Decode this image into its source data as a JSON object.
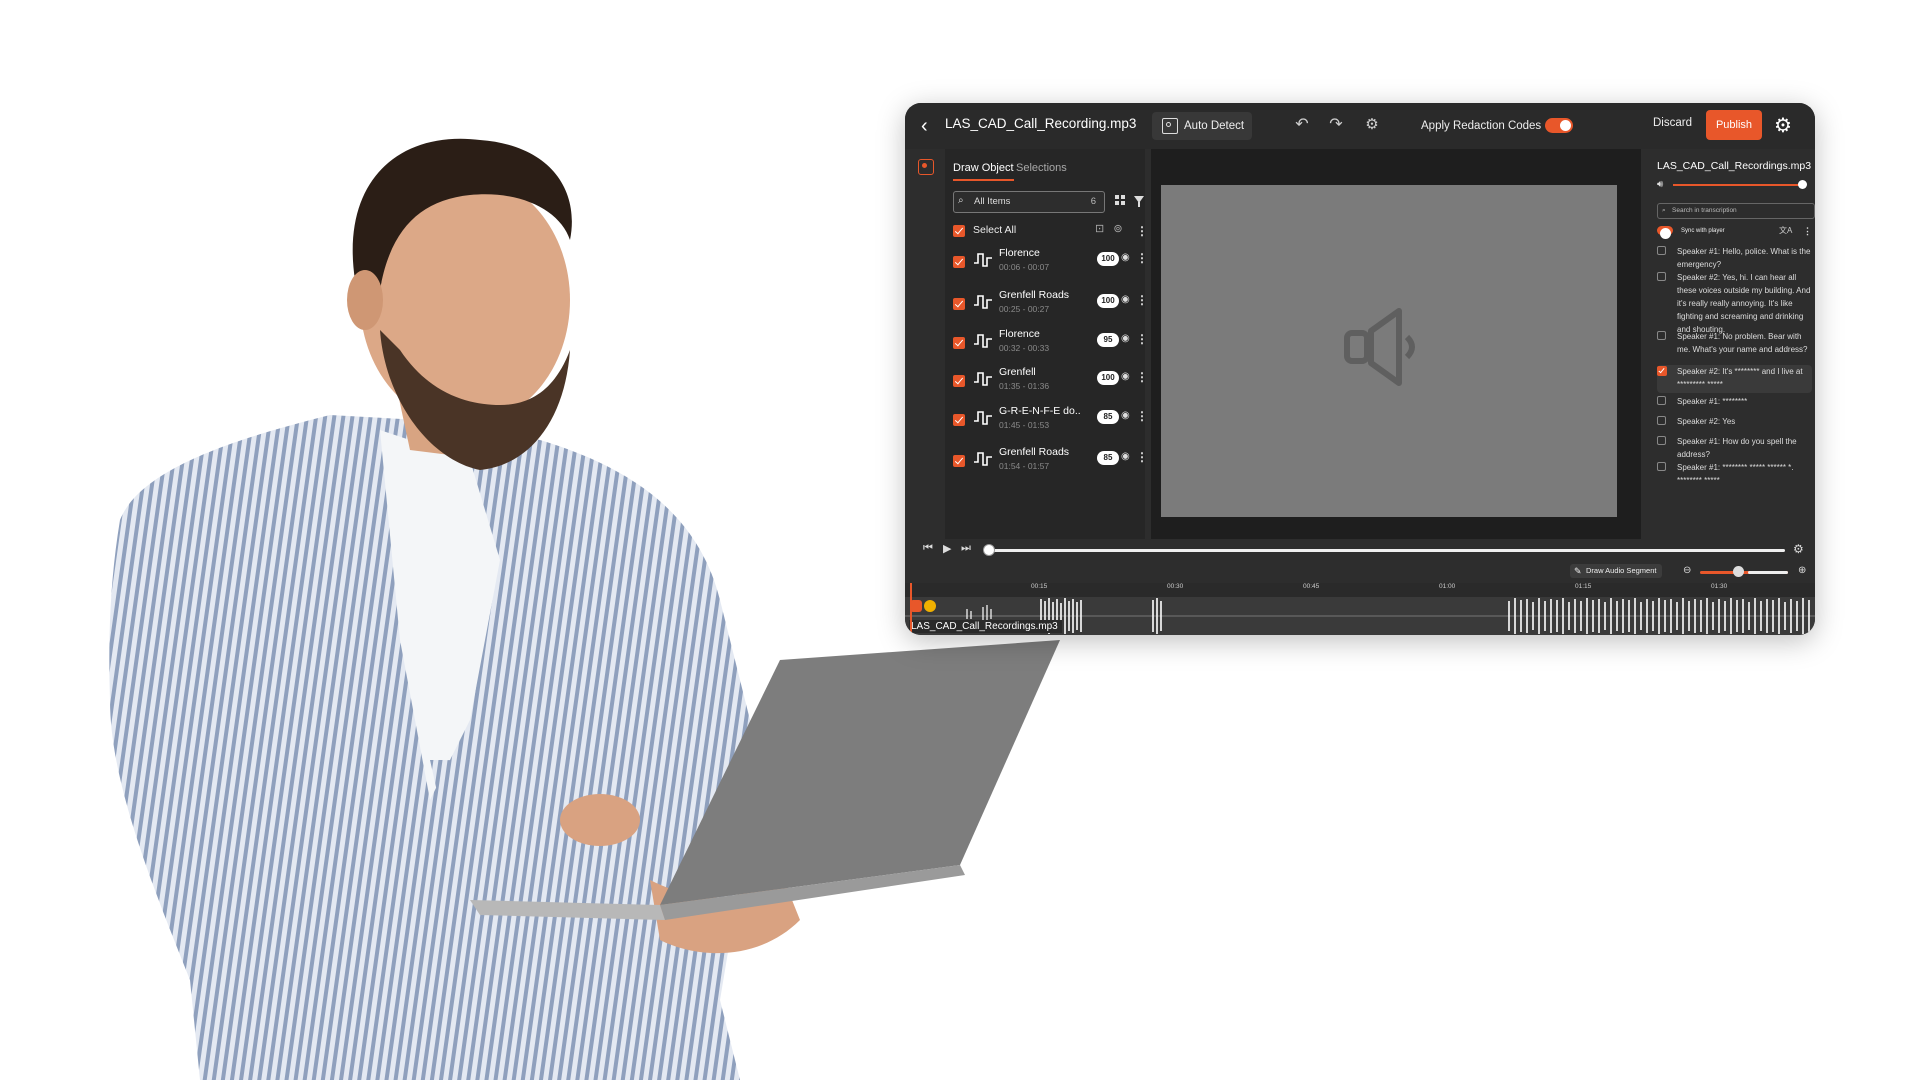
{
  "app": {
    "title": "LAS_CAD_Call_Recording.mp3",
    "auto_detect_label": "Auto Detect",
    "apply_redaction_label": "Apply Redaction Codes",
    "discard_label": "Discard",
    "publish_label": "Publish",
    "accent_color": "#e8572a"
  },
  "panel": {
    "tabs": [
      "Draw Object",
      "Selections"
    ],
    "active_tab": "Draw Object",
    "search_placeholder": "All Items",
    "item_count": "6",
    "select_all_label": "Select All",
    "items": [
      {
        "name": "Florence",
        "time": "00:06 - 00:07",
        "score": "100"
      },
      {
        "name": "Grenfell Roads",
        "time": "00:25 - 00:27",
        "score": "100"
      },
      {
        "name": "Florence",
        "time": "00:32 - 00:33",
        "score": "95"
      },
      {
        "name": "Grenfell",
        "time": "01:35 - 01:36",
        "score": "100"
      },
      {
        "name": "G-R-E-N-F-E do..",
        "time": "01:45 - 01:53",
        "score": "85"
      },
      {
        "name": "Grenfell Roads",
        "time": "01:54 - 01:57",
        "score": "85"
      }
    ]
  },
  "transcript": {
    "title": "LAS_CAD_Call_Recordings.mp3",
    "search_placeholder": "Search in transcription",
    "sync_label": "Sync with player",
    "segments": [
      {
        "text": "Speaker #1: Hello, police. What is the emergency?",
        "checked": false
      },
      {
        "text": "Speaker #2: Yes, hi. I can hear all these voices outside my building. And it's really really annoying. It's like fighting and screaming and drinking and shouting.",
        "checked": false
      },
      {
        "text": "Speaker #1: No problem. Bear with me. What's your name and address?",
        "checked": false
      },
      {
        "text": "Speaker #2: It's ******** and I live at ********* *****",
        "checked": true
      },
      {
        "text": "Speaker #1: ********",
        "checked": false
      },
      {
        "text": "Speaker #2: Yes",
        "checked": false
      },
      {
        "text": "Speaker #1: How do you spell the address?",
        "checked": false
      },
      {
        "text": "Speaker #1: ******** ***** ****** *. ******** *****",
        "checked": false
      }
    ]
  },
  "timeline": {
    "draw_audio_segment_label": "Draw Audio Segment",
    "tick_labels": [
      "00:15",
      "00:30",
      "00:45",
      "01:00",
      "01:15",
      "01:30"
    ],
    "file_name": "LAS_CAD_Call_Recordings.mp3",
    "player_progress": 0.0,
    "zoom_level": 0.35
  },
  "icons": {
    "back": "chevron-left-icon",
    "auto_detect": "target-icon",
    "undo": "undo-icon",
    "redo": "redo-icon",
    "settings": "gear-icon",
    "speaker": "speaker-icon"
  }
}
